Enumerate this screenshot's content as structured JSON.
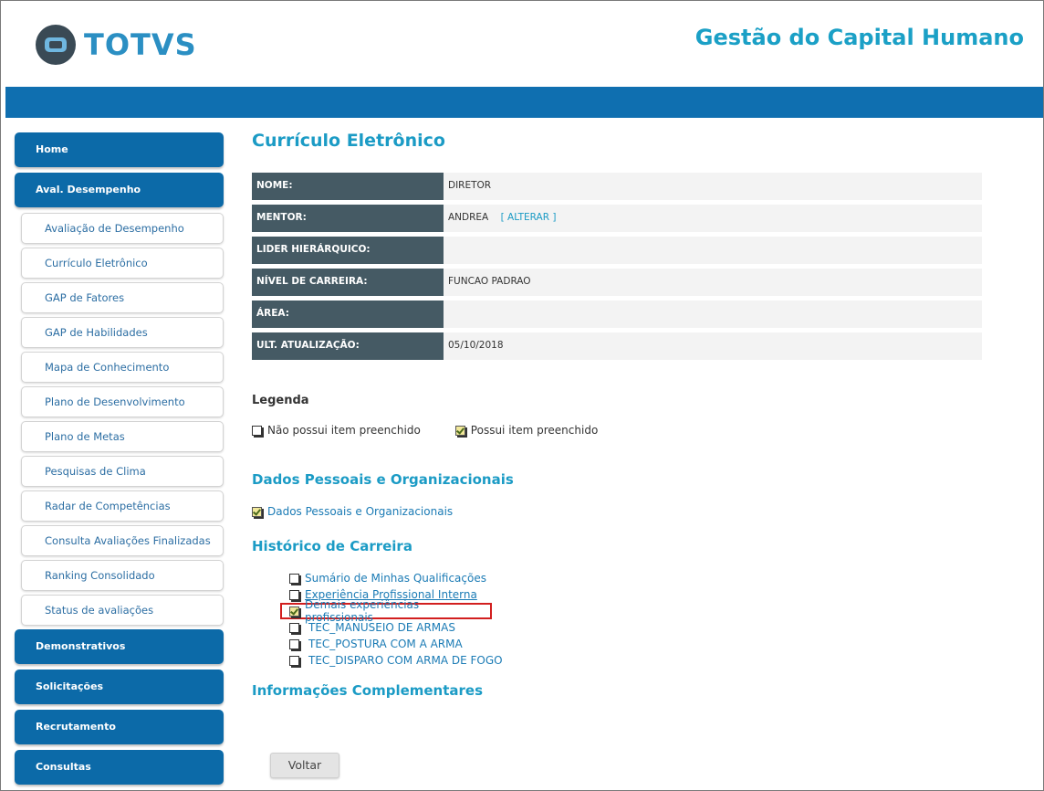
{
  "header": {
    "logo_text": "TOTVS",
    "app_title": "Gestão do Capital Humano"
  },
  "sidebar": {
    "home": "Home",
    "aval_desempenho": "Aval. Desempenho",
    "sub_items": [
      "Avaliação de Desempenho",
      "Currículo Eletrônico",
      "GAP de Fatores",
      "GAP de Habilidades",
      "Mapa de Conhecimento",
      "Plano de Desenvolvimento",
      "Plano de Metas",
      "Pesquisas de Clima",
      "Radar de Competências",
      "Consulta Avaliações Finalizadas",
      "Ranking Consolidado",
      "Status de avaliações"
    ],
    "demonstrativos": "Demonstrativos",
    "solicitacoes": "Solicitações",
    "recrutamento": "Recrutamento",
    "consultas": "Consultas"
  },
  "main": {
    "title": "Currículo Eletrônico",
    "info": [
      {
        "label": "NOME:",
        "value": "DIRETOR"
      },
      {
        "label": "MENTOR:",
        "value": "ANDREA",
        "link": "[ ALTERAR ]"
      },
      {
        "label": "LIDER HIERÁRQUICO:",
        "value": ""
      },
      {
        "label": "NÍVEL DE CARREIRA:",
        "value": "FUNCAO PADRAO"
      },
      {
        "label": "ÁREA:",
        "value": ""
      },
      {
        "label": "ULT. ATUALIZAÇÃO:",
        "value": "05/10/2018"
      }
    ],
    "legend": {
      "title": "Legenda",
      "unfilled": "Não possui item preenchido",
      "filled": "Possui item preenchido"
    },
    "section_personal": {
      "title": "Dados Pessoais e Organizacionais",
      "item": "Dados Pessoais e Organizacionais"
    },
    "section_history": {
      "title": "Histórico de Carreira",
      "items": [
        "Sumário de Minhas Qualificações",
        "Experiência Profissional Interna",
        "Demais experiências profissionais"
      ],
      "sub_items": [
        "TEC_MANUSEIO DE ARMAS",
        "TEC_POSTURA COM A ARMA",
        "TEC_DISPARO COM ARMA DE FOGO"
      ]
    },
    "section_extra": {
      "title": "Informações Complementares"
    },
    "back_button": "Voltar"
  }
}
